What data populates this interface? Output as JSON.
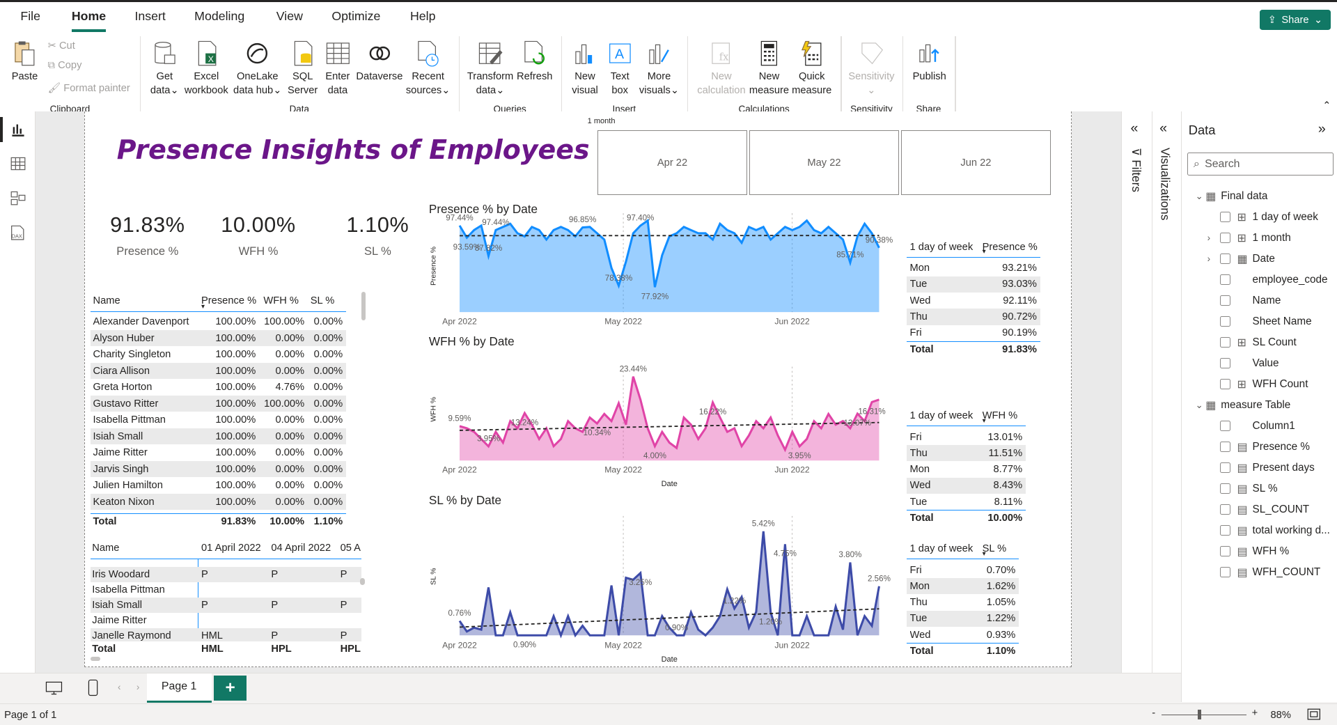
{
  "menu": {
    "file": "File",
    "home": "Home",
    "insert": "Insert",
    "modeling": "Modeling",
    "view": "View",
    "optimize": "Optimize",
    "help": "Help"
  },
  "share": "Share",
  "ribbon": {
    "paste": "Paste",
    "cut": "Cut",
    "copy": "Copy",
    "format_painter": "Format painter",
    "clipboard": "Clipboard",
    "get_data": "Get",
    "get_data2": "data",
    "excel": "Excel",
    "excel2": "workbook",
    "onelake": "OneLake",
    "onelake2": "data hub",
    "sql": "SQL",
    "sql2": "Server",
    "enter": "Enter",
    "enter2": "data",
    "dataverse": "Dataverse",
    "recent": "Recent",
    "recent2": "sources",
    "data_group": "Data",
    "transform": "Transform",
    "transform2": "data",
    "refresh": "Refresh",
    "queries": "Queries",
    "new_visual": "New",
    "new_visual2": "visual",
    "text_box": "Text",
    "text_box2": "box",
    "more_visuals": "More",
    "more_visuals2": "visuals",
    "insert_group": "Insert",
    "new_calc": "New",
    "new_calc2": "calculation",
    "new_measure": "New",
    "new_measure2": "measure",
    "quick_measure": "Quick",
    "quick_measure2": "measure",
    "calculations": "Calculations",
    "sensitivity": "Sensitivity",
    "sensitivity_group": "Sensitivity",
    "publish": "Publish",
    "share_group": "Share"
  },
  "report": {
    "title": "Presence Insights of  Employees",
    "slicer_header": "1 month",
    "slicer_items": [
      "Apr 22",
      "May 22",
      "Jun 22"
    ],
    "cards": [
      {
        "value": "91.83%",
        "label": "Presence %"
      },
      {
        "value": "10.00%",
        "label": "WFH %"
      },
      {
        "value": "1.10%",
        "label": "SL %"
      }
    ],
    "table": {
      "headers": [
        "Name",
        "Presence %",
        "WFH %",
        "SL %"
      ],
      "rows": [
        [
          "Alexander Davenport",
          "100.00%",
          "100.00%",
          "0.00%"
        ],
        [
          "Alyson Huber",
          "100.00%",
          "0.00%",
          "0.00%"
        ],
        [
          "Charity Singleton",
          "100.00%",
          "0.00%",
          "0.00%"
        ],
        [
          "Ciara Allison",
          "100.00%",
          "0.00%",
          "0.00%"
        ],
        [
          "Greta Horton",
          "100.00%",
          "4.76%",
          "0.00%"
        ],
        [
          "Gustavo Ritter",
          "100.00%",
          "100.00%",
          "0.00%"
        ],
        [
          "Isabella Pittman",
          "100.00%",
          "0.00%",
          "0.00%"
        ],
        [
          "Isiah Small",
          "100.00%",
          "0.00%",
          "0.00%"
        ],
        [
          "Jaime Ritter",
          "100.00%",
          "0.00%",
          "0.00%"
        ],
        [
          "Jarvis Singh",
          "100.00%",
          "0.00%",
          "0.00%"
        ],
        [
          "Julien Hamilton",
          "100.00%",
          "0.00%",
          "0.00%"
        ],
        [
          "Keaton Nixon",
          "100.00%",
          "0.00%",
          "0.00%"
        ]
      ],
      "total": [
        "Total",
        "91.83%",
        "10.00%",
        "1.10%"
      ]
    },
    "matrix": {
      "headers": [
        "Name",
        "01 April 2022",
        "04 April 2022",
        "05 A"
      ],
      "rows": [
        [
          "Iris Woodard",
          "P",
          "P",
          "P"
        ],
        [
          "Isabella Pittman",
          "",
          "",
          ""
        ],
        [
          "Isiah Small",
          "P",
          "P",
          "P"
        ],
        [
          "Jaime Ritter",
          "",
          "",
          ""
        ],
        [
          "Janelle Raymond",
          "HML",
          "P",
          "P"
        ]
      ],
      "total": [
        "Total",
        "HML",
        "HPL",
        "HPL"
      ]
    },
    "presence_chart_title": "Presence % by Date",
    "wfh_chart_title": "WFH % by Date",
    "sl_chart_title": "SL % by Date",
    "presence_day": {
      "headers": [
        "1 day of week",
        "Presence %"
      ],
      "rows": [
        [
          "Mon",
          "93.21%"
        ],
        [
          "Tue",
          "93.03%"
        ],
        [
          "Wed",
          "92.11%"
        ],
        [
          "Thu",
          "90.72%"
        ],
        [
          "Fri",
          "90.19%"
        ]
      ],
      "total": [
        "Total",
        "91.83%"
      ]
    },
    "wfh_day": {
      "headers": [
        "1 day of week",
        "WFH %"
      ],
      "rows": [
        [
          "Fri",
          "13.01%"
        ],
        [
          "Thu",
          "11.51%"
        ],
        [
          "Mon",
          "8.77%"
        ],
        [
          "Wed",
          "8.43%"
        ],
        [
          "Tue",
          "8.11%"
        ]
      ],
      "total": [
        "Total",
        "10.00%"
      ]
    },
    "sl_day": {
      "headers": [
        "1 day of week",
        "SL %"
      ],
      "rows": [
        [
          "Fri",
          "0.70%"
        ],
        [
          "Mon",
          "1.62%"
        ],
        [
          "Thu",
          "1.05%"
        ],
        [
          "Tue",
          "1.22%"
        ],
        [
          "Wed",
          "0.93%"
        ]
      ],
      "total": [
        "Total",
        "1.10%"
      ]
    }
  },
  "chart_data": [
    {
      "type": "area",
      "title": "Presence % by Date",
      "xlabel": "",
      "ylabel": "Presence %",
      "x_ticks": [
        "Apr 2022",
        "May 2022",
        "Jun 2022"
      ],
      "color": "#118dff",
      "values": [
        97.44,
        93.59,
        96,
        97.44,
        87.82,
        96,
        97,
        98,
        95,
        94,
        97,
        96,
        93,
        96,
        97,
        96,
        94,
        96.85,
        97,
        95,
        93,
        84,
        78.38,
        86,
        95,
        97.4,
        99,
        77.92,
        88,
        94,
        95,
        97,
        96,
        95,
        95,
        93,
        98,
        96,
        95,
        92,
        97,
        96,
        97,
        93,
        95,
        97,
        96,
        97,
        99,
        96,
        95,
        97,
        95,
        93,
        85.71,
        94,
        98,
        95,
        90.38
      ],
      "labels": [
        [
          0,
          "97.44%"
        ],
        [
          1,
          "93.59%"
        ],
        [
          4,
          "87.82%"
        ],
        [
          5,
          "97.44%"
        ],
        [
          17,
          "96.85%"
        ],
        [
          22,
          "78.38%"
        ],
        [
          25,
          "97.40%"
        ],
        [
          27,
          "77.92%"
        ],
        [
          54,
          "85.71%"
        ],
        [
          58,
          "90.38%"
        ]
      ]
    },
    {
      "type": "area",
      "title": "WFH % by Date",
      "xlabel": "Date",
      "ylabel": "WFH %",
      "x_ticks": [
        "Apr 2022",
        "May 2022",
        "Jun 2022"
      ],
      "color": "#e044a7",
      "values": [
        9.59,
        9,
        8,
        6,
        3.95,
        8,
        5,
        11,
        9,
        13.24,
        10,
        6,
        9,
        4,
        6,
        11,
        9,
        8,
        12,
        10.34,
        13,
        11,
        16,
        10,
        23.44,
        17,
        9,
        4,
        8,
        5,
        3.5,
        12,
        10,
        6,
        9,
        16.22,
        12,
        8,
        9,
        4,
        7,
        11,
        9,
        12,
        7,
        3,
        8,
        3.95,
        6,
        11,
        9,
        13,
        10,
        11,
        9,
        13.07,
        11,
        16.31,
        17
      ],
      "labels": [
        [
          0,
          "9.59%"
        ],
        [
          4,
          "3.95%"
        ],
        [
          9,
          "13.24%"
        ],
        [
          19,
          "10.34%"
        ],
        [
          24,
          "23.44%"
        ],
        [
          27,
          "4.00%"
        ],
        [
          35,
          "16.22%"
        ],
        [
          47,
          "3.95%"
        ],
        [
          55,
          "13.07%"
        ],
        [
          57,
          "16.31%"
        ]
      ]
    },
    {
      "type": "area",
      "title": "SL % by Date",
      "xlabel": "Date",
      "ylabel": "SL %",
      "x_ticks": [
        "Apr 2022",
        "May 2022",
        "Jun 2022"
      ],
      "color": "#3d4ba8",
      "values": [
        0.75,
        0.2,
        0.4,
        0.3,
        2.5,
        0,
        0,
        1.2,
        0,
        0,
        0,
        0,
        0,
        1,
        0,
        1,
        0,
        0.5,
        0,
        0,
        0,
        2.6,
        0,
        3.0,
        2.9,
        3.25,
        0,
        0,
        1,
        0.4,
        0,
        0,
        1.2,
        0.3,
        0,
        0.4,
        1.0,
        2.4,
        1.4,
        2,
        0.4,
        1.22,
        5.42,
        1.2,
        0,
        4.75,
        0,
        0,
        1,
        0,
        0,
        0,
        1.5,
        0.3,
        3.8,
        0,
        1,
        0.5,
        2.56
      ],
      "labels": [
        [
          0,
          "0.76%"
        ],
        [
          9,
          "0.90%"
        ],
        [
          25,
          "3.25%"
        ],
        [
          30,
          "0.90%"
        ],
        [
          38,
          "1.22%"
        ],
        [
          42,
          "5.42%"
        ],
        [
          43,
          "1.20%"
        ],
        [
          45,
          "4.75%"
        ],
        [
          54,
          "3.80%"
        ],
        [
          58,
          "2.56%"
        ]
      ]
    }
  ],
  "fields": {
    "header": "Data",
    "search": "Search",
    "items": [
      {
        "label": "Final data",
        "level": 0,
        "icon": "table-icon",
        "expand": "v"
      },
      {
        "label": "1 day of week",
        "level": 1,
        "icon": "calc-column-icon"
      },
      {
        "label": "1 month",
        "level": 1,
        "icon": "calc-column-icon",
        "expand": ">"
      },
      {
        "label": "Date",
        "level": 1,
        "icon": "table-icon",
        "expand": ">"
      },
      {
        "label": "employee_code",
        "level": 1,
        "icon": ""
      },
      {
        "label": "Name",
        "level": 1,
        "icon": ""
      },
      {
        "label": "Sheet Name",
        "level": 1,
        "icon": ""
      },
      {
        "label": "SL Count",
        "level": 1,
        "icon": "calc-column-icon"
      },
      {
        "label": "Value",
        "level": 1,
        "icon": ""
      },
      {
        "label": "WFH Count",
        "level": 1,
        "icon": "calc-column-icon"
      },
      {
        "label": "measure Table",
        "level": 0,
        "icon": "table-icon",
        "expand": "v"
      },
      {
        "label": "Column1",
        "level": 1,
        "icon": ""
      },
      {
        "label": "Presence %",
        "level": 1,
        "icon": "measure-icon"
      },
      {
        "label": "Present days",
        "level": 1,
        "icon": "measure-icon"
      },
      {
        "label": "SL %",
        "level": 1,
        "icon": "measure-icon"
      },
      {
        "label": "SL_COUNT",
        "level": 1,
        "icon": "measure-icon"
      },
      {
        "label": "total working d...",
        "level": 1,
        "icon": "measure-icon"
      },
      {
        "label": "WFH %",
        "level": 1,
        "icon": "measure-icon"
      },
      {
        "label": "WFH_COUNT",
        "level": 1,
        "icon": "measure-icon"
      }
    ]
  },
  "panes": {
    "filters": "Filters",
    "visualizations": "Visualizations"
  },
  "pages": {
    "tab": "Page 1",
    "add": "+"
  },
  "status": {
    "page": "Page 1 of 1",
    "zoom": "88%",
    "minus": "-",
    "plus": "+"
  }
}
